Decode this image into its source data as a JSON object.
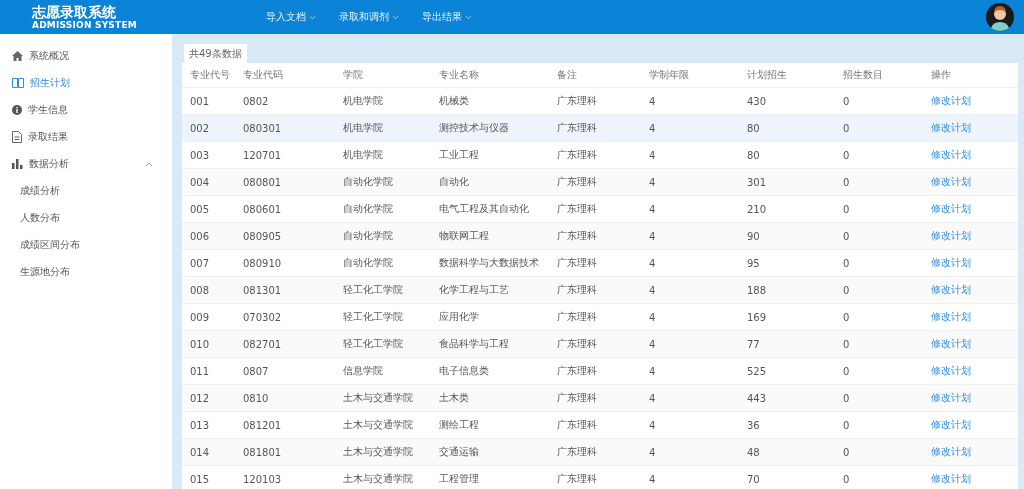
{
  "header": {
    "title": "志愿录取系统",
    "subtitle": "ADMISSION SYSTEM",
    "menu": [
      {
        "label": "导入文档"
      },
      {
        "label": "录取和调剂"
      },
      {
        "label": "导出结果"
      }
    ]
  },
  "sidebar": {
    "items": [
      {
        "label": "系统概况",
        "kind": "home",
        "selected": false
      },
      {
        "label": "招生计划",
        "kind": "book",
        "selected": true
      },
      {
        "label": "学生信息",
        "kind": "info",
        "selected": false
      },
      {
        "label": "录取结果",
        "kind": "doc",
        "selected": false
      },
      {
        "label": "数据分析",
        "kind": "chart",
        "selected": false,
        "expanded": true,
        "children": [
          {
            "label": "成绩分析",
            "selected": false
          },
          {
            "label": "人数分布",
            "selected": false
          },
          {
            "label": "成绩区间分布",
            "selected": false
          },
          {
            "label": "生源地分布",
            "selected": false
          }
        ]
      }
    ]
  },
  "tab": {
    "label": "共49条数据"
  },
  "table": {
    "columns": [
      "专业代号",
      "专业代码",
      "学院",
      "专业名称",
      "备注",
      "学制年限",
      "计划招生",
      "招生数目",
      "操作"
    ],
    "rows": [
      {
        "cells": [
          "001",
          "0802",
          "机电学院",
          "机械类",
          "广东理科",
          "4",
          "430",
          "0"
        ],
        "action": "修改计划",
        "selected": false
      },
      {
        "cells": [
          "002",
          "080301",
          "机电学院",
          "测控技术与仪器",
          "广东理科",
          "4",
          "80",
          "0"
        ],
        "action": "修改计划",
        "selected": true
      },
      {
        "cells": [
          "003",
          "120701",
          "机电学院",
          "工业工程",
          "广东理科",
          "4",
          "80",
          "0"
        ],
        "action": "修改计划",
        "selected": false
      },
      {
        "cells": [
          "004",
          "080801",
          "自动化学院",
          "自动化",
          "广东理科",
          "4",
          "301",
          "0"
        ],
        "action": "修改计划",
        "selected": false
      },
      {
        "cells": [
          "005",
          "080601",
          "自动化学院",
          "电气工程及其自动化",
          "广东理科",
          "4",
          "210",
          "0"
        ],
        "action": "修改计划",
        "selected": false
      },
      {
        "cells": [
          "006",
          "080905",
          "自动化学院",
          "物联网工程",
          "广东理科",
          "4",
          "90",
          "0"
        ],
        "action": "修改计划",
        "selected": false
      },
      {
        "cells": [
          "007",
          "080910",
          "自动化学院",
          "数据科学与大数据技术",
          "广东理科",
          "4",
          "95",
          "0"
        ],
        "action": "修改计划",
        "selected": false
      },
      {
        "cells": [
          "008",
          "081301",
          "轻工化工学院",
          "化学工程与工艺",
          "广东理科",
          "4",
          "188",
          "0"
        ],
        "action": "修改计划",
        "selected": false
      },
      {
        "cells": [
          "009",
          "070302",
          "轻工化工学院",
          "应用化学",
          "广东理科",
          "4",
          "169",
          "0"
        ],
        "action": "修改计划",
        "selected": false
      },
      {
        "cells": [
          "010",
          "082701",
          "轻工化工学院",
          "食品科学与工程",
          "广东理科",
          "4",
          "77",
          "0"
        ],
        "action": "修改计划",
        "selected": false
      },
      {
        "cells": [
          "011",
          "0807",
          "信息学院",
          "电子信息类",
          "广东理科",
          "4",
          "525",
          "0"
        ],
        "action": "修改计划",
        "selected": false
      },
      {
        "cells": [
          "012",
          "0810",
          "土木与交通学院",
          "土木类",
          "广东理科",
          "4",
          "443",
          "0"
        ],
        "action": "修改计划",
        "selected": false
      },
      {
        "cells": [
          "013",
          "081201",
          "土木与交通学院",
          "测绘工程",
          "广东理科",
          "4",
          "36",
          "0"
        ],
        "action": "修改计划",
        "selected": false
      },
      {
        "cells": [
          "014",
          "081801",
          "土木与交通学院",
          "交通运输",
          "广东理科",
          "4",
          "48",
          "0"
        ],
        "action": "修改计划",
        "selected": false
      },
      {
        "cells": [
          "015",
          "120103",
          "土木与交通学院",
          "工程管理",
          "广东理科",
          "4",
          "70",
          "0"
        ],
        "action": "修改计划",
        "selected": false
      }
    ]
  }
}
